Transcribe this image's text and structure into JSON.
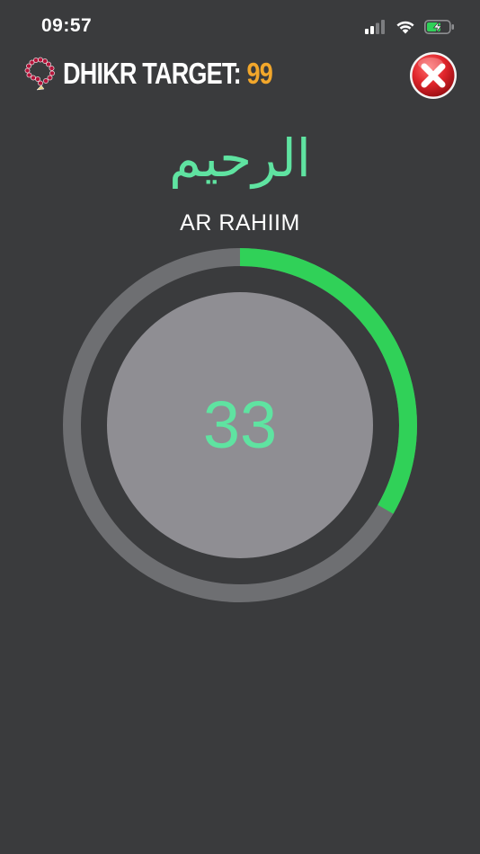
{
  "status_bar": {
    "time": "09:57",
    "icons": [
      "signal-icon",
      "wifi-icon",
      "battery-charging-icon"
    ]
  },
  "header": {
    "title_label": "DHIKR TARGET: ",
    "target_value": "99",
    "icon": "tasbih-beads-icon",
    "close_icon": "close-icon"
  },
  "name": {
    "arabic": "الرحيم",
    "latin": "AR RAHIIM"
  },
  "counter": {
    "count": "33",
    "progress_fraction": 0.3333
  },
  "colors": {
    "background": "#3a3b3d",
    "accent_green": "#5fe3a1",
    "progress_green": "#30d158",
    "target_orange": "#f2a72b",
    "ring_track": "#6e6f72",
    "counter_face": "#8f8e93",
    "close_red": "#e0252b"
  }
}
